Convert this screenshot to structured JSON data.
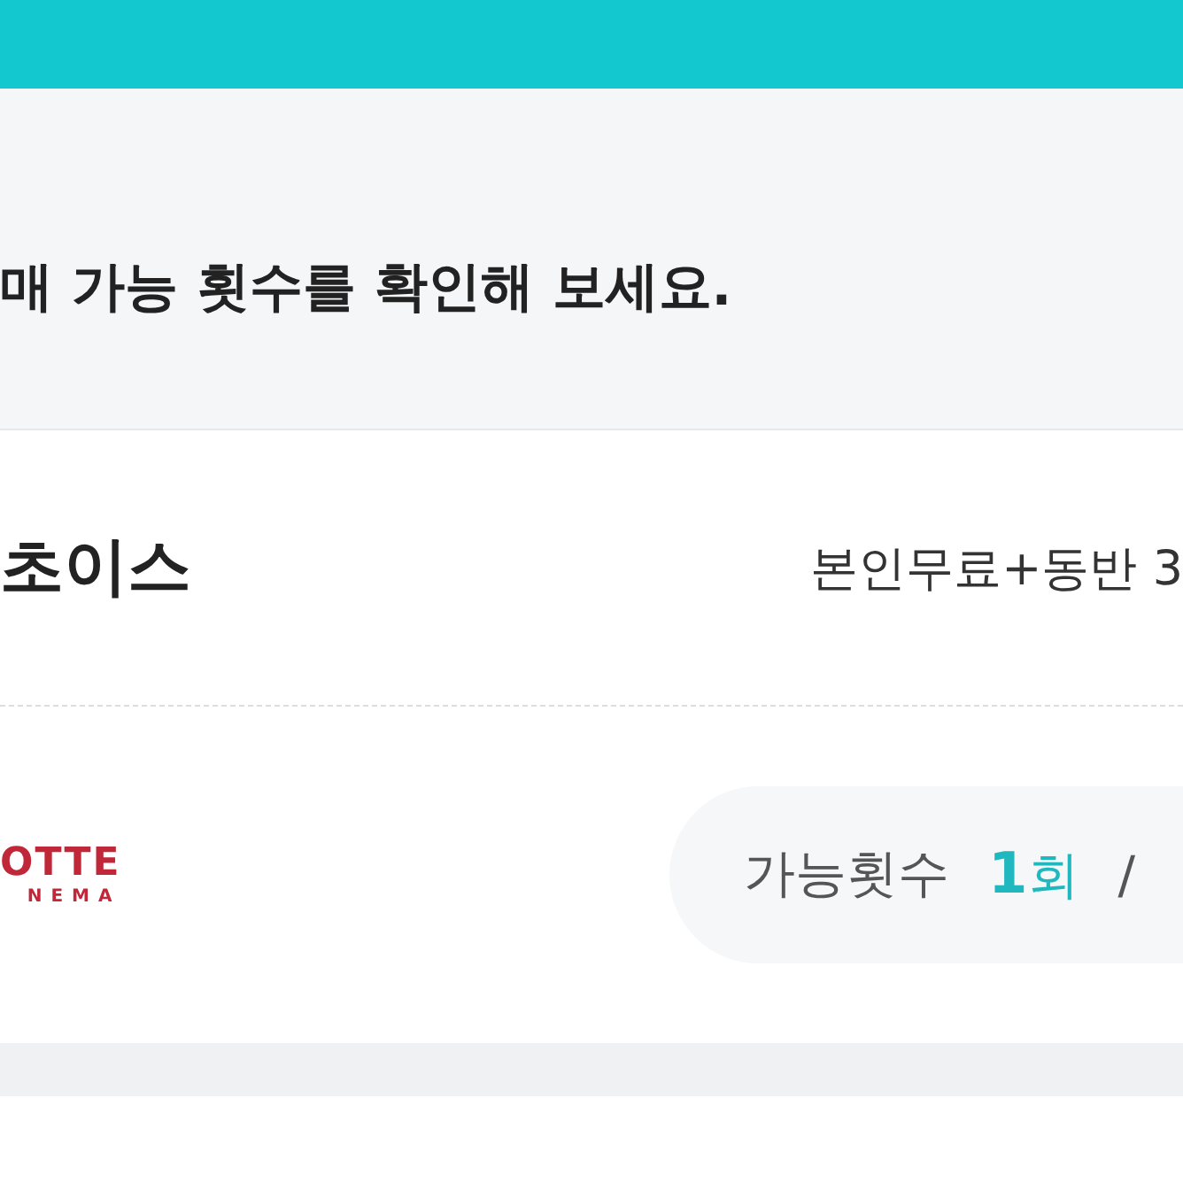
{
  "header_bar": {
    "color": "#14c8cf"
  },
  "notice": {
    "text": "매 가능 횟수를 확인해 보세요."
  },
  "card": {
    "title": "초이스",
    "benefit": "본인무료+동반 3",
    "cinema": {
      "logo_top": "OTTE",
      "logo_bottom": "NEMA",
      "count_label": "가능횟수",
      "count_number": "1",
      "count_unit": "회",
      "separator": "/"
    }
  }
}
